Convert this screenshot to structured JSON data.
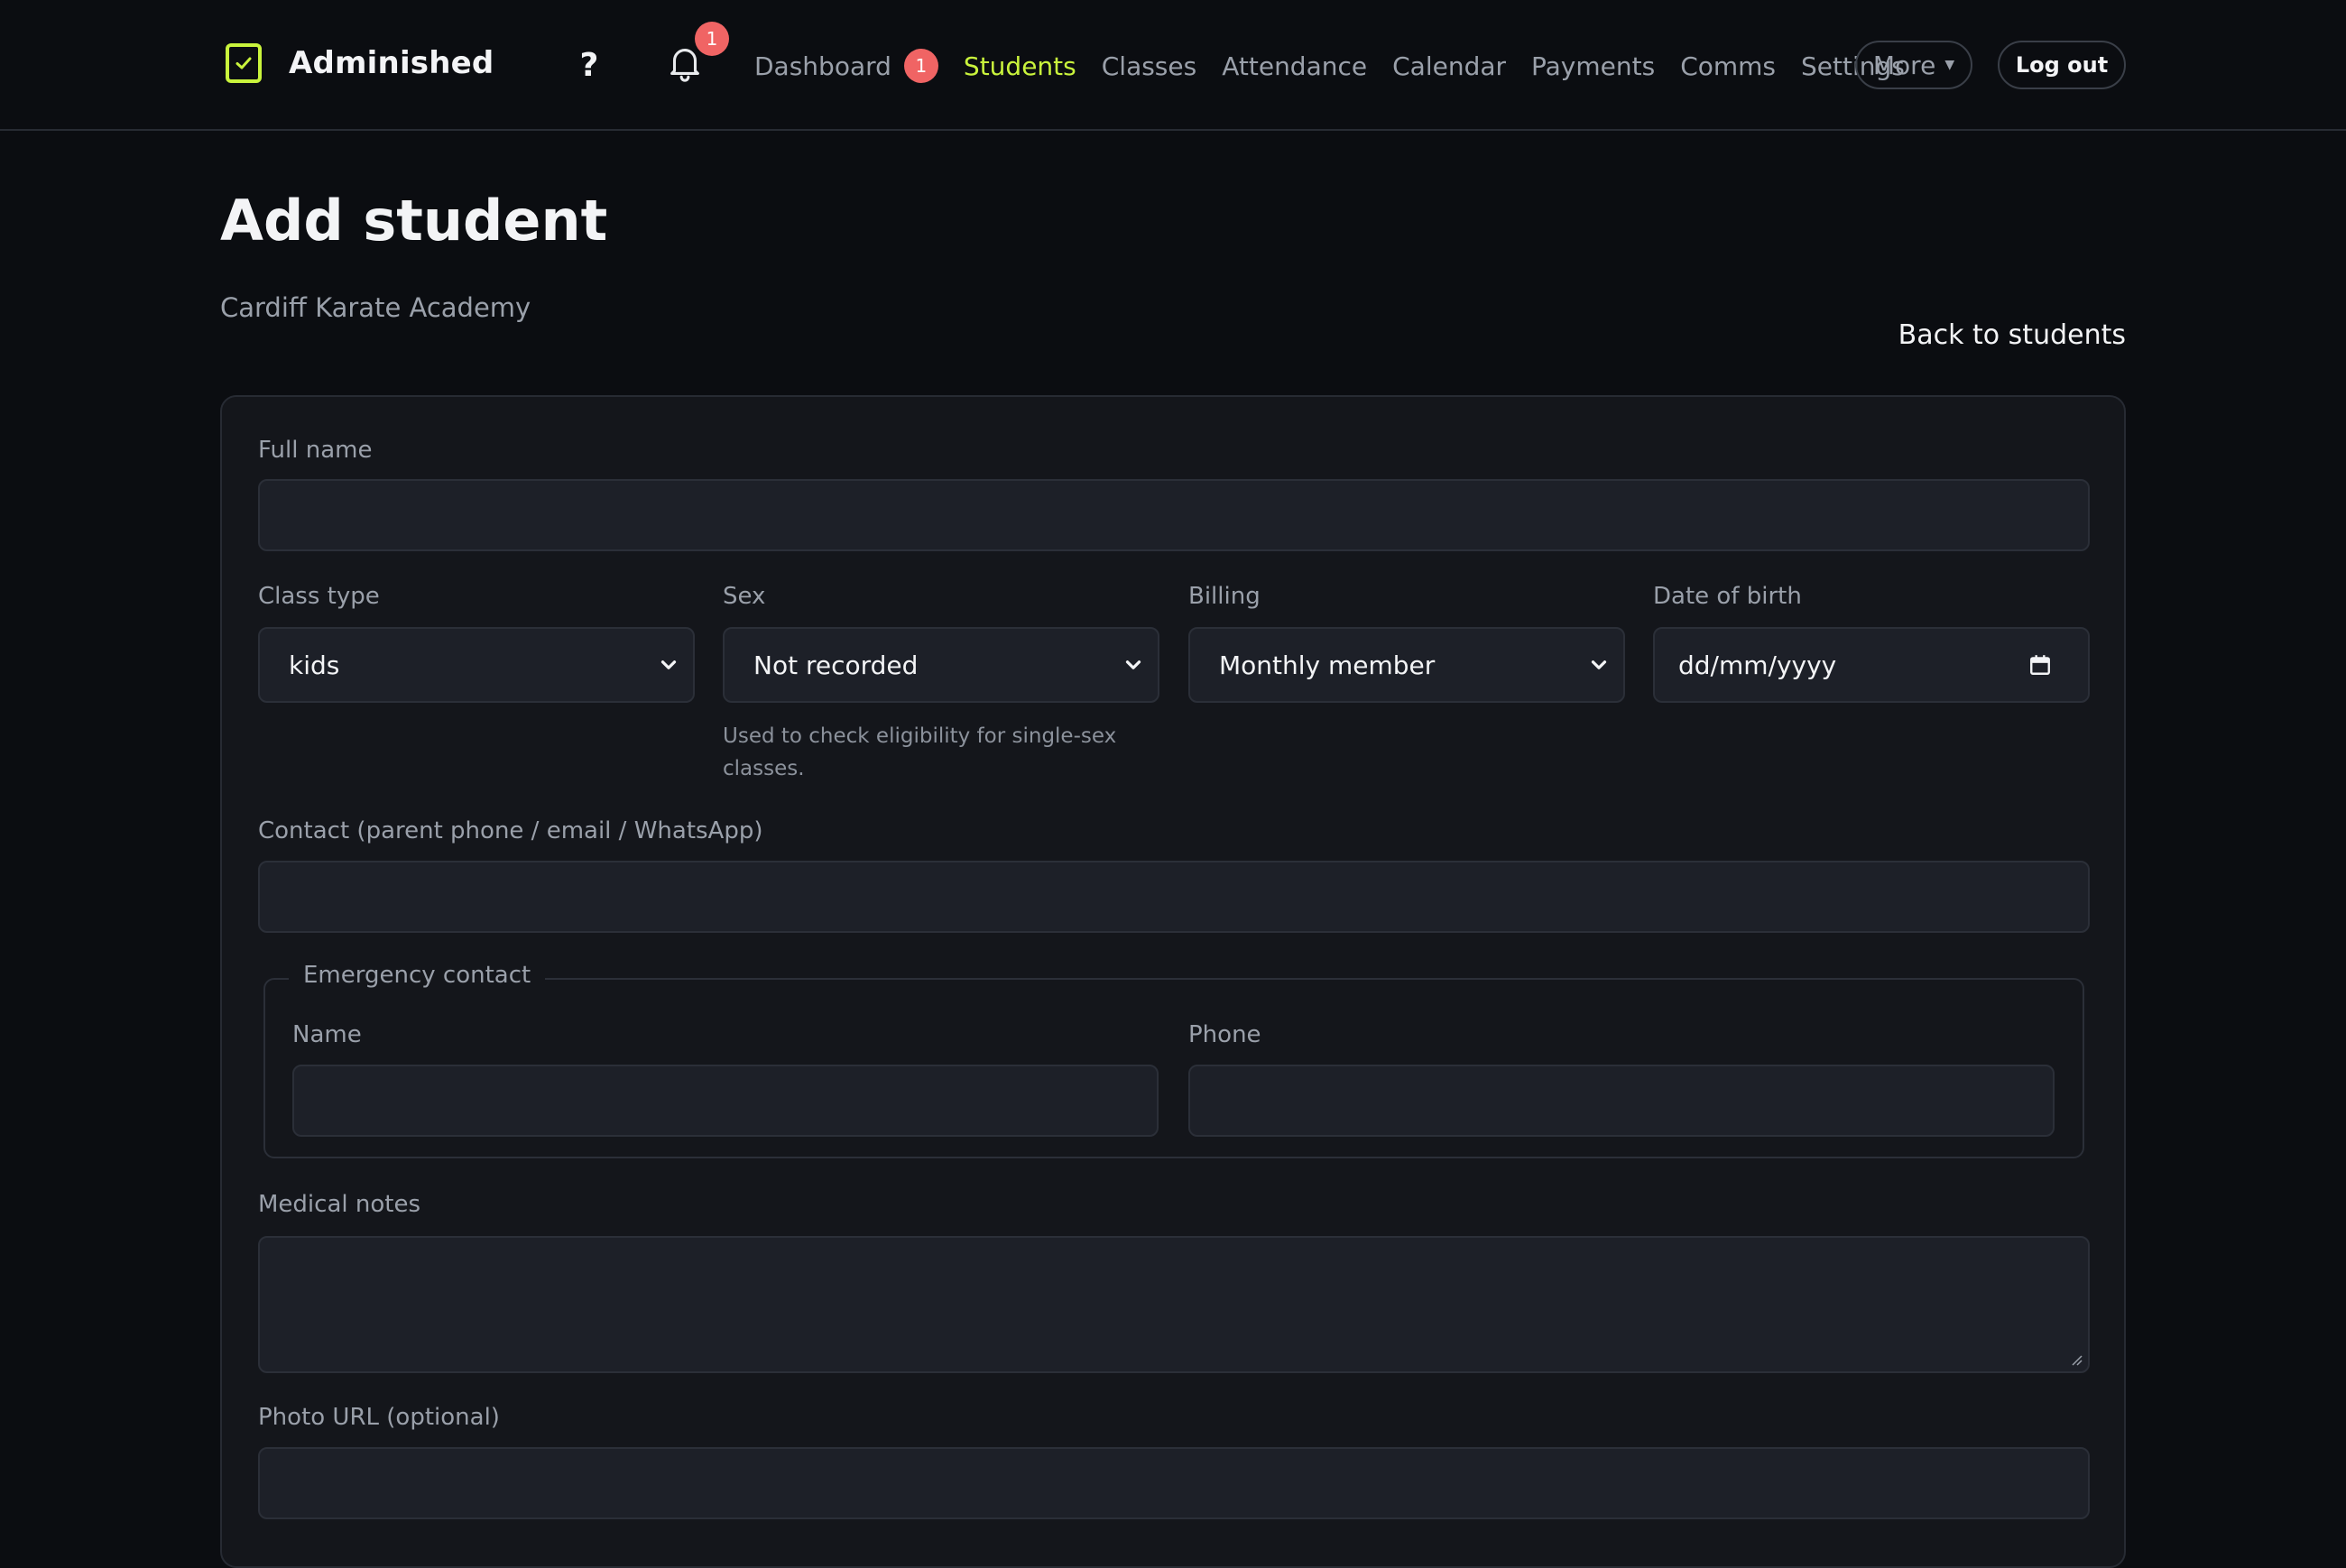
{
  "app": {
    "name": "Adminished",
    "help_label": "?",
    "notifications_count": "1"
  },
  "nav": {
    "items": [
      {
        "label": "Dashboard",
        "badge": "1"
      },
      {
        "label": "Students"
      },
      {
        "label": "Classes"
      },
      {
        "label": "Attendance"
      },
      {
        "label": "Calendar"
      },
      {
        "label": "Payments"
      },
      {
        "label": "Comms"
      },
      {
        "label": "Settings"
      }
    ],
    "active": "Students",
    "more_label": "More",
    "logout_label": "Log out"
  },
  "page": {
    "title": "Add student",
    "subtitle": "Cardiff Karate Academy",
    "back_link": "Back to students"
  },
  "form": {
    "full_name": {
      "label": "Full name",
      "value": ""
    },
    "class_type": {
      "label": "Class type",
      "value": "kids"
    },
    "sex": {
      "label": "Sex",
      "value": "Not recorded",
      "hint": "Used to check eligibility for single-sex classes."
    },
    "billing": {
      "label": "Billing",
      "value": "Monthly member"
    },
    "date_of_birth": {
      "label": "Date of birth",
      "placeholder": "dd/mm/yyyy"
    },
    "contact": {
      "label": "Contact (parent phone / email / WhatsApp)",
      "value": ""
    },
    "emergency_contact": {
      "legend": "Emergency contact",
      "name": {
        "label": "Name",
        "value": ""
      },
      "phone": {
        "label": "Phone",
        "value": ""
      }
    },
    "medical_notes": {
      "label": "Medical notes",
      "value": ""
    },
    "photo_url": {
      "label": "Photo URL (optional)",
      "value": ""
    }
  },
  "colors": {
    "accent": "#c9f33c",
    "badge": "#f06464",
    "background": "#0b0d11",
    "card": "#14161b",
    "field": "#1d2028"
  }
}
